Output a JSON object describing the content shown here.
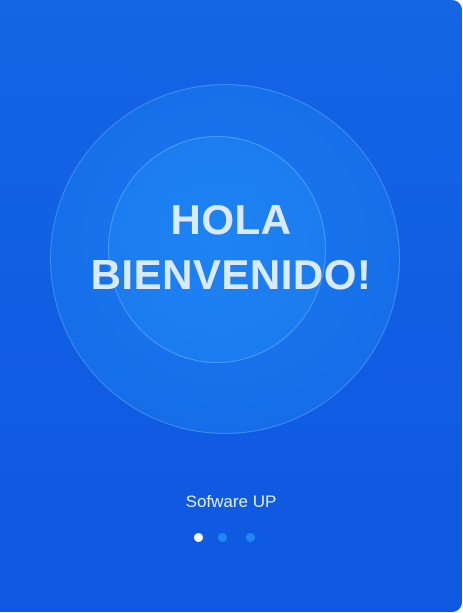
{
  "welcome": {
    "line1": "HOLA",
    "line2": "BIENVENIDO!"
  },
  "brand": {
    "name": "Sofware UP"
  },
  "pagination": {
    "total": 3,
    "active_index": 0
  },
  "colors": {
    "background": "#115de3",
    "text": "#dbeafb",
    "dot_active": "#ffffff",
    "dot_inactive": "#1f88f2"
  }
}
